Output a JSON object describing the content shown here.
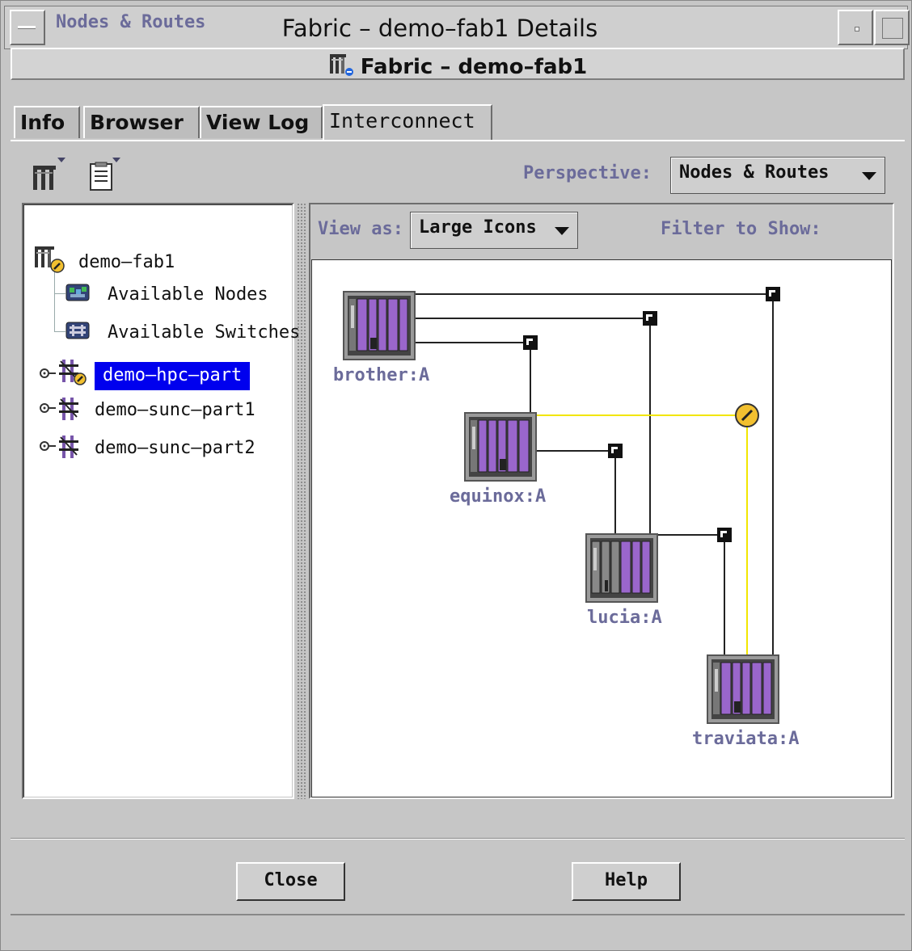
{
  "window": {
    "title": "Fabric – demo–fab1 Details"
  },
  "header": {
    "title": "Fabric – demo–fab1"
  },
  "tabs": [
    {
      "label": "Info"
    },
    {
      "label": "Browser"
    },
    {
      "label": "View Log"
    },
    {
      "label": "Interconnect"
    }
  ],
  "toolbar": {
    "perspective_label": "Perspective:",
    "perspective_value": "Nodes & Routes"
  },
  "tree": {
    "heading": "Nodes & Routes",
    "items": [
      {
        "label": "demo–fab1",
        "icon": "fabric-icon"
      },
      {
        "label": "Available Nodes",
        "icon": "nodes-icon"
      },
      {
        "label": "Available Switches",
        "icon": "switches-icon"
      },
      {
        "label": "demo–hpc–part",
        "icon": "partition-icon",
        "selected": true
      },
      {
        "label": "demo–sunc–part1",
        "icon": "partition-icon"
      },
      {
        "label": "demo–sunc–part2",
        "icon": "partition-icon"
      }
    ]
  },
  "view": {
    "view_as_label": "View as:",
    "view_as_value": "Large Icons",
    "filter_label": "Filter to Show:"
  },
  "nodes": [
    {
      "label": "brother:A"
    },
    {
      "label": "equinox:A"
    },
    {
      "label": "lucia:A"
    },
    {
      "label": "traviata:A"
    }
  ],
  "buttons": {
    "close": "Close",
    "help": "Help"
  },
  "colors": {
    "accent": "#6b6b9a",
    "selection": "#0000ee",
    "route_highlight": "#f2e600",
    "node_purple": "#9a66cc"
  }
}
